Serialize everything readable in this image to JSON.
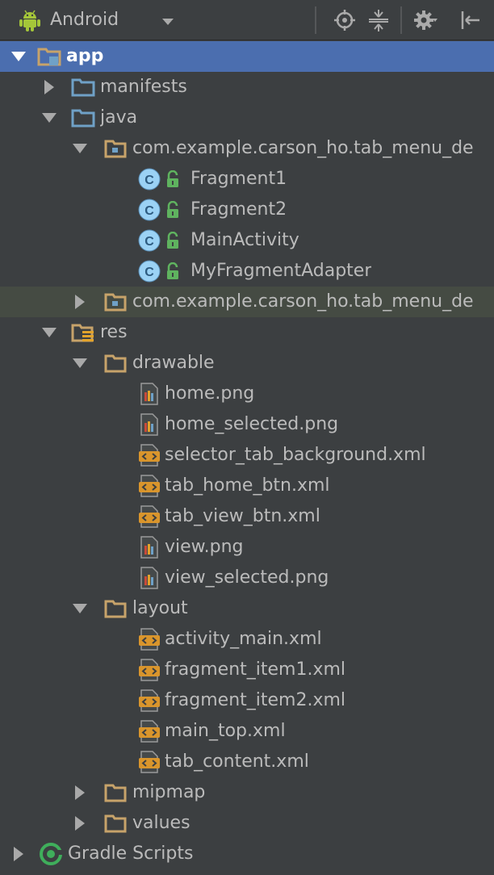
{
  "toolbar": {
    "view_selector": "Android",
    "icons": [
      "android-icon",
      "chevron-down-icon",
      "locate-icon",
      "collapse-all-icon",
      "gear-icon",
      "hide-panel-icon"
    ]
  },
  "colors": {
    "background": "#3c3f41",
    "selection": "#4b6eaf",
    "hover": "#454b43",
    "folder": "#c7a36a",
    "folder_blue": "#6fa1c7",
    "class_circle": "#9bd2f5",
    "lock": "#5fb35f"
  },
  "tree": [
    {
      "label": "app",
      "depth": 0,
      "expanded": true,
      "icon": "module-folder-icon",
      "selected": true
    },
    {
      "label": "manifests",
      "depth": 1,
      "expanded": false,
      "icon": "folder-blue-icon"
    },
    {
      "label": "java",
      "depth": 1,
      "expanded": true,
      "icon": "folder-blue-icon"
    },
    {
      "label": "com.example.carson_ho.tab_menu_de",
      "depth": 2,
      "expanded": true,
      "icon": "package-icon"
    },
    {
      "label": "Fragment1",
      "depth": 3,
      "icon": "class-icon"
    },
    {
      "label": "Fragment2",
      "depth": 3,
      "icon": "class-icon"
    },
    {
      "label": "MainActivity",
      "depth": 3,
      "icon": "class-icon"
    },
    {
      "label": "MyFragmentAdapter",
      "depth": 3,
      "icon": "class-icon"
    },
    {
      "label": "com.example.carson_ho.tab_menu_de",
      "depth": 2,
      "expanded": false,
      "icon": "package-icon",
      "hover": true
    },
    {
      "label": "res",
      "depth": 1,
      "expanded": true,
      "icon": "res-folder-icon"
    },
    {
      "label": "drawable",
      "depth": 2,
      "expanded": true,
      "icon": "folder-icon"
    },
    {
      "label": "home.png",
      "depth": 3,
      "icon": "image-file-icon"
    },
    {
      "label": "home_selected.png",
      "depth": 3,
      "icon": "image-file-icon"
    },
    {
      "label": "selector_tab_background.xml",
      "depth": 3,
      "icon": "xml-file-icon"
    },
    {
      "label": "tab_home_btn.xml",
      "depth": 3,
      "icon": "xml-file-icon"
    },
    {
      "label": "tab_view_btn.xml",
      "depth": 3,
      "icon": "xml-file-icon"
    },
    {
      "label": "view.png",
      "depth": 3,
      "icon": "image-file-icon"
    },
    {
      "label": "view_selected.png",
      "depth": 3,
      "icon": "image-file-icon"
    },
    {
      "label": "layout",
      "depth": 2,
      "expanded": true,
      "icon": "folder-icon"
    },
    {
      "label": "activity_main.xml",
      "depth": 3,
      "icon": "xml-file-icon"
    },
    {
      "label": "fragment_item1.xml",
      "depth": 3,
      "icon": "xml-file-icon"
    },
    {
      "label": "fragment_item2.xml",
      "depth": 3,
      "icon": "xml-file-icon"
    },
    {
      "label": "main_top.xml",
      "depth": 3,
      "icon": "xml-file-icon"
    },
    {
      "label": "tab_content.xml",
      "depth": 3,
      "icon": "xml-file-icon"
    },
    {
      "label": "mipmap",
      "depth": 2,
      "expanded": false,
      "icon": "folder-icon"
    },
    {
      "label": "values",
      "depth": 2,
      "expanded": false,
      "icon": "folder-icon"
    },
    {
      "label": "Gradle Scripts",
      "depth": 0,
      "expanded": false,
      "icon": "gradle-icon"
    }
  ]
}
